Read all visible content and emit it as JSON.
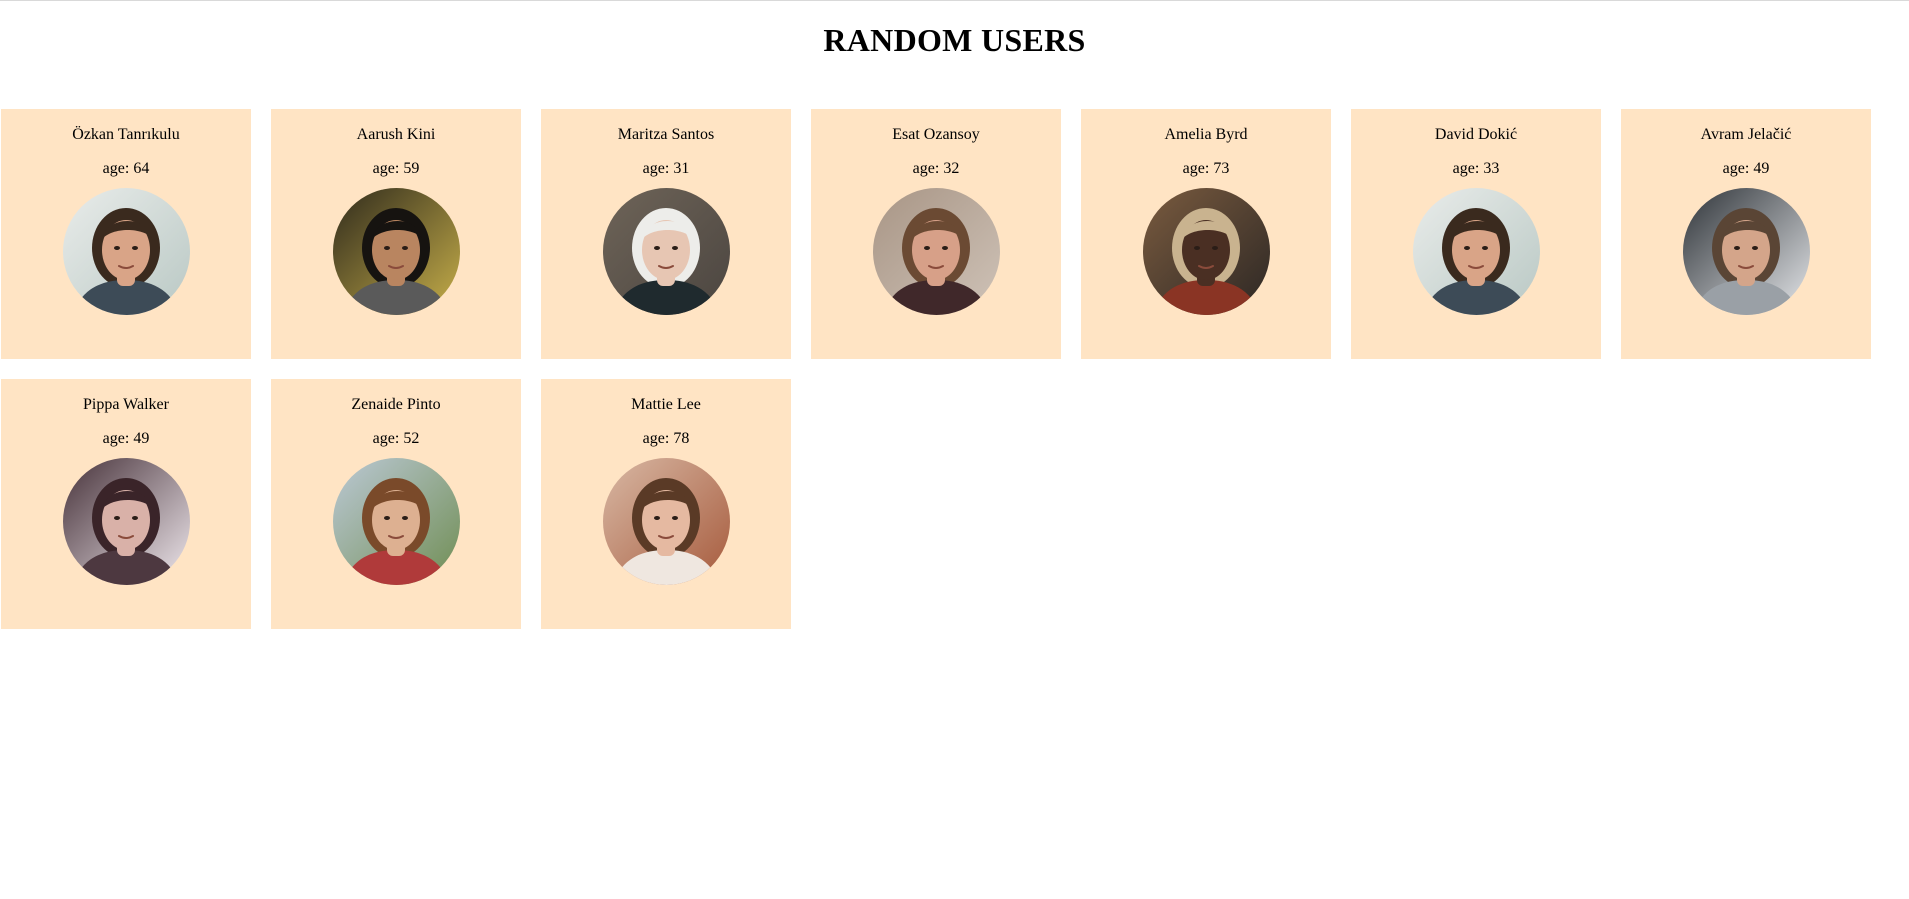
{
  "page": {
    "title": "RANDOM USERS",
    "card_color": "#ffe4c4"
  },
  "users": [
    {
      "name": "Özkan Tanrıkulu",
      "age_prefix": "age: ",
      "age": 64,
      "avatar": {
        "bg": "#b9c8c4",
        "bg2": "#e9ecea",
        "skin": "#d9a487",
        "hair": "#3a2a1e",
        "shirt": "#3d4b57"
      }
    },
    {
      "name": "Aarush Kini",
      "age_prefix": "age: ",
      "age": 59,
      "avatar": {
        "bg": "#c8b04a",
        "bg2": "#2f2a1c",
        "skin": "#b98560",
        "hair": "#161310",
        "shirt": "#5a5a5a"
      }
    },
    {
      "name": "Maritza Santos",
      "age_prefix": "age: ",
      "age": 31,
      "avatar": {
        "bg": "#4b4540",
        "bg2": "#6e6458",
        "skin": "#e7c6b3",
        "hair": "#ededea",
        "shirt": "#1f2a2e"
      }
    },
    {
      "name": "Esat Ozansoy",
      "age_prefix": "age: ",
      "age": 32,
      "avatar": {
        "bg": "#cfc3b8",
        "bg2": "#a89585",
        "skin": "#d7a088",
        "hair": "#6b4a33",
        "shirt": "#40282a"
      }
    },
    {
      "name": "Amelia Byrd",
      "age_prefix": "age: ",
      "age": 73,
      "avatar": {
        "bg": "#2c2724",
        "bg2": "#7a5b3f",
        "skin": "#4a2f23",
        "hair": "#c9b38f",
        "shirt": "#8a3424"
      }
    },
    {
      "name": "David Dokić",
      "age_prefix": "age: ",
      "age": 33,
      "avatar": {
        "bg": "#b9c8c4",
        "bg2": "#e9ecea",
        "skin": "#d9a487",
        "hair": "#3a2a1e",
        "shirt": "#3d4b57"
      }
    },
    {
      "name": "Avram Jelačić",
      "age_prefix": "age: ",
      "age": 49,
      "avatar": {
        "bg": "#e6e8eb",
        "bg2": "#2e3338",
        "skin": "#d4a58a",
        "hair": "#5a4535",
        "shirt": "#9aa0a6"
      }
    },
    {
      "name": "Pippa Walker",
      "age_prefix": "age: ",
      "age": 49,
      "avatar": {
        "bg": "#f1eaef",
        "bg2": "#463139",
        "skin": "#d9b1a8",
        "hair": "#3a2429",
        "shirt": "#4d3840"
      }
    },
    {
      "name": "Zenaide Pinto",
      "age_prefix": "age: ",
      "age": 52,
      "avatar": {
        "bg": "#6f8d52",
        "bg2": "#bcc9d6",
        "skin": "#ddb091",
        "hair": "#7a4a2a",
        "shirt": "#b03a3a"
      }
    },
    {
      "name": "Mattie Lee",
      "age_prefix": "age: ",
      "age": 78,
      "avatar": {
        "bg": "#a65a3c",
        "bg2": "#d8b8a4",
        "skin": "#e5b9a1",
        "hair": "#5a3a26",
        "shirt": "#efe7e0"
      }
    }
  ]
}
